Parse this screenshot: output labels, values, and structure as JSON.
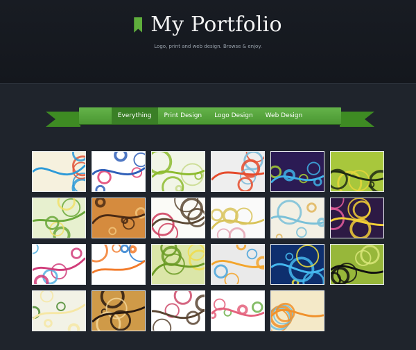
{
  "header": {
    "title": "My Portfolio",
    "subtitle": "Logo, print and web design. Browse & enjoy."
  },
  "nav": {
    "tabs": [
      {
        "label": "Everything",
        "active": true
      },
      {
        "label": "Print Design",
        "active": false
      },
      {
        "label": "Logo Design",
        "active": false
      },
      {
        "label": "Web Design",
        "active": false
      }
    ]
  },
  "gallery": {
    "thumbnails": [
      {
        "bg": "#f6f1de",
        "accent": "#2d9ad8",
        "accent2": "#e0553b"
      },
      {
        "bg": "#ffffff",
        "accent": "#2f5fb8",
        "accent2": "#e03c6e"
      },
      {
        "bg": "#f1f5e7",
        "accent": "#8dbb2f",
        "accent2": "#c7d989"
      },
      {
        "bg": "#eeeeee",
        "accent": "#e54b2c",
        "accent2": "#78b8d8"
      },
      {
        "bg": "#2b1b54",
        "accent": "#3fb1e8",
        "accent2": "#a7cf35"
      },
      {
        "bg": "#a8c73c",
        "accent": "#1f2a14",
        "accent2": "#e7d63a"
      },
      {
        "bg": "#e7f0cf",
        "accent": "#6aa83a",
        "accent2": "#f1e06a"
      },
      {
        "bg": "#d58b3e",
        "accent": "#4a2a14",
        "accent2": "#f2c47a"
      },
      {
        "bg": "#fbfbf7",
        "accent": "#5c4934",
        "accent2": "#cc3a5a"
      },
      {
        "bg": "#fafafa",
        "accent": "#d8c35a",
        "accent2": "#e4a5b4"
      },
      {
        "bg": "#f3f0e4",
        "accent": "#79c0d8",
        "accent2": "#e0b55a"
      },
      {
        "bg": "#2d1a44",
        "accent": "#f2cf36",
        "accent2": "#e85e9c"
      },
      {
        "bg": "#ffffff",
        "accent": "#d13c7a",
        "accent2": "#53b0e0"
      },
      {
        "bg": "#ffffff",
        "accent": "#f27b2b",
        "accent2": "#2d7fd0"
      },
      {
        "bg": "#dbe6a8",
        "accent": "#6a9a25",
        "accent2": "#f0dc4a"
      },
      {
        "bg": "#eaeaea",
        "accent": "#f3a52c",
        "accent2": "#4aa5db"
      },
      {
        "bg": "#0e2f6e",
        "accent": "#45b8ef",
        "accent2": "#f2e23a"
      },
      {
        "bg": "#97b73a",
        "accent": "#101010",
        "accent2": "#d9e77a"
      },
      {
        "bg": "#f2f2e6",
        "accent": "#f6e7a5",
        "accent2": "#4a8a2e"
      },
      {
        "bg": "#cf9a48",
        "accent": "#2a1a10",
        "accent2": "#f4d79a"
      },
      {
        "bg": "#ffffff",
        "accent": "#5a4532",
        "accent2": "#cc4a6a"
      },
      {
        "bg": "#ffffff",
        "accent": "#e4627d",
        "accent2": "#6fb04c"
      },
      {
        "bg": "#f4e9c8",
        "accent": "#f0912b",
        "accent2": "#6ec1e4"
      }
    ]
  }
}
